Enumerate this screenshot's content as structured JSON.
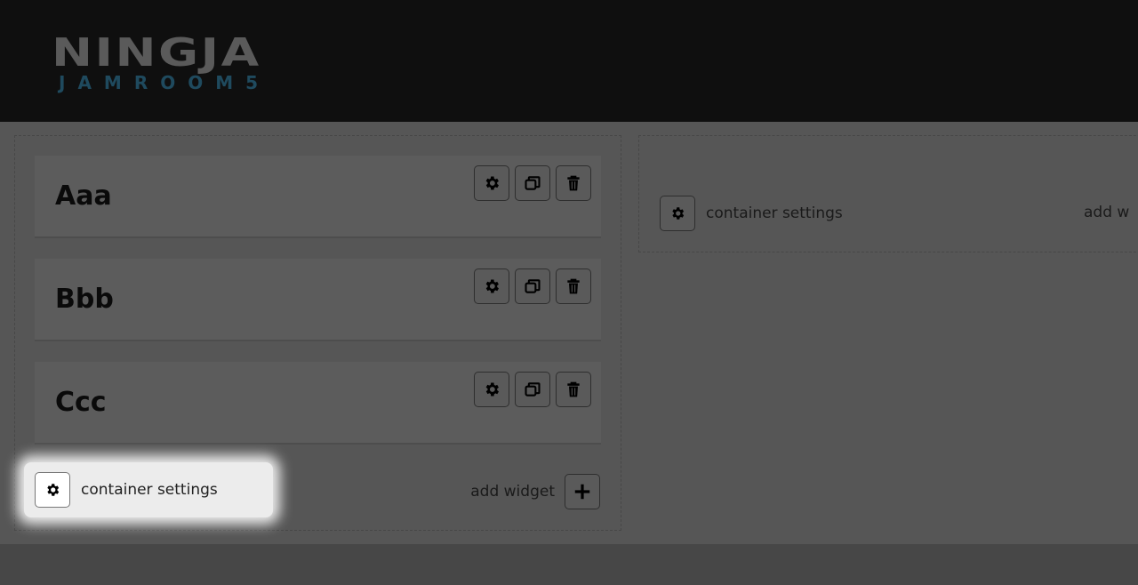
{
  "header": {
    "logo_main": "NINGJA",
    "logo_sub": "JAMROOM5"
  },
  "containers": [
    {
      "widgets": [
        {
          "title": "Aaa"
        },
        {
          "title": "Bbb"
        },
        {
          "title": "Ccc"
        }
      ],
      "settings_label": "container settings",
      "add_widget_label": "add widget"
    },
    {
      "widgets": [],
      "settings_label": "container settings",
      "add_widget_label": "add w"
    }
  ],
  "icons": {
    "widget_settings": "gear-icon",
    "widget_clone": "windows-icon",
    "widget_delete": "trash-icon",
    "add": "plus-icon"
  },
  "colors": {
    "header_bg": "#0f0f0f",
    "logo_main": "#5a5a5a",
    "logo_sub": "#1f4a5e",
    "highlight": "#ececec"
  }
}
